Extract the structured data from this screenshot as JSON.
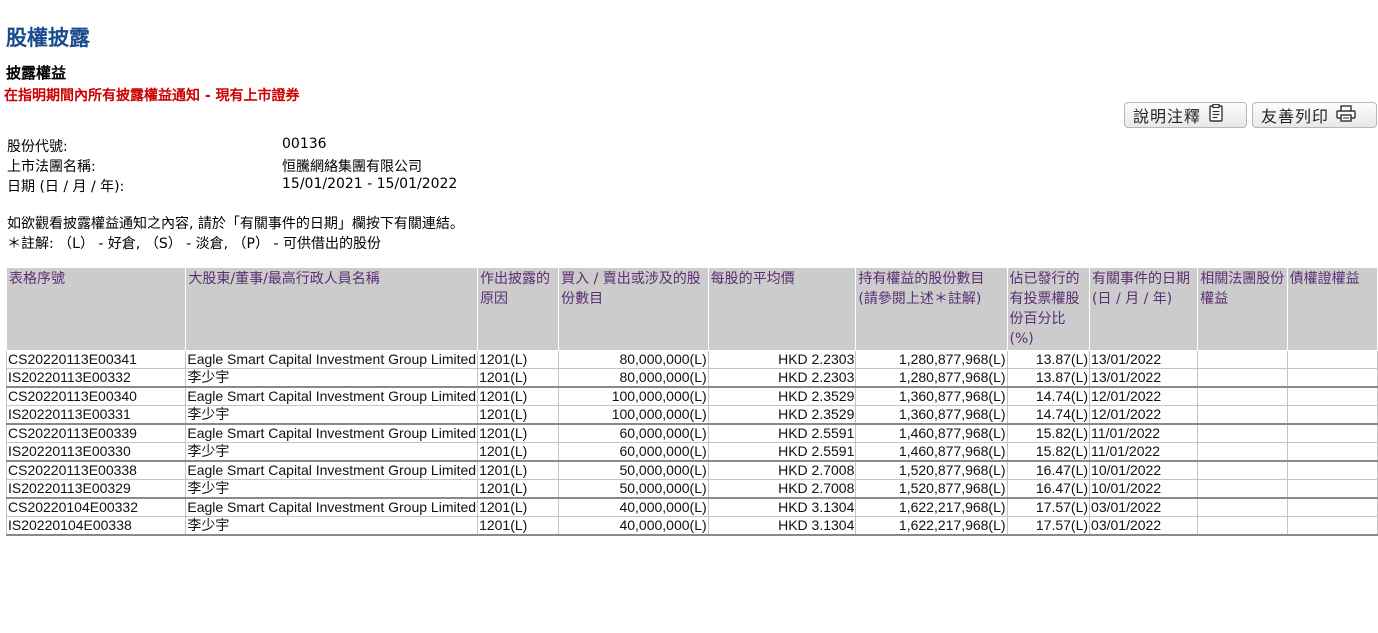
{
  "header": {
    "page_title": "股權披露",
    "section_title": "披露權益",
    "subtitle": "在指明期間內所有披露權益通知 - 現有上市證券"
  },
  "buttons": {
    "explain": "說明注釋",
    "print": "友善列印"
  },
  "info": {
    "stock_code_label": "股份代號:",
    "stock_code": "00136",
    "company_label": "上市法團名稱:",
    "company": "恒騰網絡集團有限公司",
    "date_label": "日期 (日 / 月 / 年):",
    "date_range": "15/01/2021 - 15/01/2022"
  },
  "notes": {
    "line1": "如欲觀看披露權益通知之內容, 請於「有關事件的日期」欄按下有關連結。",
    "line2": "＊註解: （L） - 好倉, （S） - 淡倉, （P） - 可供借出的股份"
  },
  "table": {
    "headers": [
      "表格序號",
      "大股東/董事/最高行政人員名稱",
      "作出披露的原因",
      "買入 / 賣出或涉及的股份數目",
      "每股的平均價",
      "持有權益的股份數目 (請參閱上述＊註解)",
      "佔已發行的有投票權股份百分比 (%)",
      "有關事件的日期 (日 / 月 / 年)",
      "相關法團股份權益",
      "債權證權益"
    ],
    "rows": [
      {
        "id": "CS20220113E00341",
        "name": "Eagle Smart Capital Investment Group Limited",
        "reason": "1201(L)",
        "shares": "80,000,000(L)",
        "price": "HKD 2.2303",
        "holding": "1,280,877,968(L)",
        "pct": "13.87(L)",
        "date": "13/01/2022",
        "assoc": "",
        "deb": ""
      },
      {
        "id": "IS20220113E00332",
        "name": "李少宇",
        "reason": "1201(L)",
        "shares": "80,000,000(L)",
        "price": "HKD 2.2303",
        "holding": "1,280,877,968(L)",
        "pct": "13.87(L)",
        "date": "13/01/2022",
        "assoc": "",
        "deb": ""
      },
      {
        "id": "CS20220113E00340",
        "name": "Eagle Smart Capital Investment Group Limited",
        "reason": "1201(L)",
        "shares": "100,000,000(L)",
        "price": "HKD 2.3529",
        "holding": "1,360,877,968(L)",
        "pct": "14.74(L)",
        "date": "12/01/2022",
        "assoc": "",
        "deb": ""
      },
      {
        "id": "IS20220113E00331",
        "name": "李少宇",
        "reason": "1201(L)",
        "shares": "100,000,000(L)",
        "price": "HKD 2.3529",
        "holding": "1,360,877,968(L)",
        "pct": "14.74(L)",
        "date": "12/01/2022",
        "assoc": "",
        "deb": ""
      },
      {
        "id": "CS20220113E00339",
        "name": "Eagle Smart Capital Investment Group Limited",
        "reason": "1201(L)",
        "shares": "60,000,000(L)",
        "price": "HKD 2.5591",
        "holding": "1,460,877,968(L)",
        "pct": "15.82(L)",
        "date": "11/01/2022",
        "assoc": "",
        "deb": ""
      },
      {
        "id": "IS20220113E00330",
        "name": "李少宇",
        "reason": "1201(L)",
        "shares": "60,000,000(L)",
        "price": "HKD 2.5591",
        "holding": "1,460,877,968(L)",
        "pct": "15.82(L)",
        "date": "11/01/2022",
        "assoc": "",
        "deb": ""
      },
      {
        "id": "CS20220113E00338",
        "name": "Eagle Smart Capital Investment Group Limited",
        "reason": "1201(L)",
        "shares": "50,000,000(L)",
        "price": "HKD 2.7008",
        "holding": "1,520,877,968(L)",
        "pct": "16.47(L)",
        "date": "10/01/2022",
        "assoc": "",
        "deb": ""
      },
      {
        "id": "IS20220113E00329",
        "name": "李少宇",
        "reason": "1201(L)",
        "shares": "50,000,000(L)",
        "price": "HKD 2.7008",
        "holding": "1,520,877,968(L)",
        "pct": "16.47(L)",
        "date": "10/01/2022",
        "assoc": "",
        "deb": ""
      },
      {
        "id": "CS20220104E00332",
        "name": "Eagle Smart Capital Investment Group Limited",
        "reason": "1201(L)",
        "shares": "40,000,000(L)",
        "price": "HKD 3.1304",
        "holding": "1,622,217,968(L)",
        "pct": "17.57(L)",
        "date": "03/01/2022",
        "assoc": "",
        "deb": ""
      },
      {
        "id": "IS20220104E00338",
        "name": "李少宇",
        "reason": "1201(L)",
        "shares": "40,000,000(L)",
        "price": "HKD 3.1304",
        "holding": "1,622,217,968(L)",
        "pct": "17.57(L)",
        "date": "03/01/2022",
        "assoc": "",
        "deb": ""
      }
    ]
  }
}
